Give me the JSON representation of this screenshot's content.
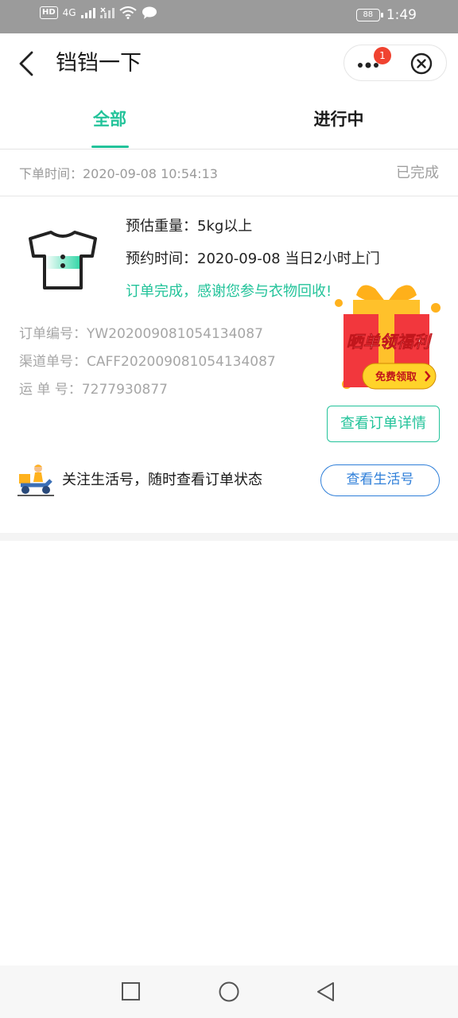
{
  "status_bar": {
    "hd_label": "HD",
    "network": "4G",
    "battery": "88",
    "time": "1:49"
  },
  "header": {
    "title": "铛铛一下",
    "capsule_badge": "1"
  },
  "tabs": [
    {
      "label": "全部",
      "active": true
    },
    {
      "label": "进行中",
      "active": false
    }
  ],
  "order": {
    "time_text": "下单时间：2020-09-08 10:54:13",
    "status": "已完成",
    "weight_text": "预估重量：5kg以上",
    "appointment_text": "预约时间：2020-09-08 当日2小时上门",
    "thanks_text": "订单完成，感谢您参与衣物回收!",
    "order_no_text": "订单编号：YW202009081054134087",
    "channel_no_text": "渠道单号：CAFF202009081054134087",
    "waybill_text": "运 单 号：7277930877",
    "detail_button": "查看订单详情"
  },
  "promo": {
    "title": "晒单领福利",
    "button": "免费领取"
  },
  "follow": {
    "text": "关注生活号，随时查看订单状态",
    "button": "查看生活号"
  },
  "colors": {
    "accent_green": "#23c39a",
    "link_blue": "#2f7fd9",
    "status_bar": "#9b9b9b",
    "badge_red": "#f04330"
  }
}
